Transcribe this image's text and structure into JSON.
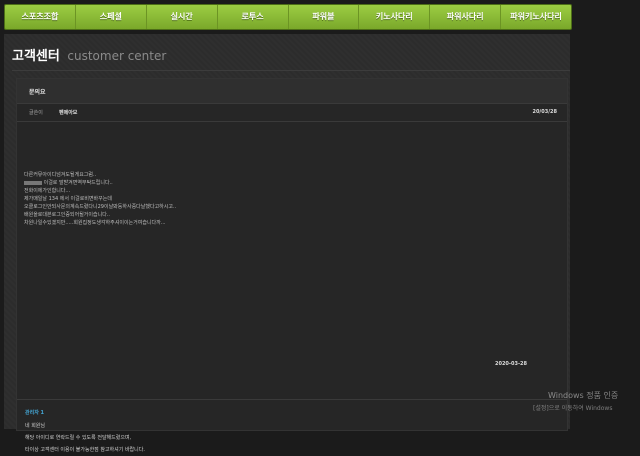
{
  "nav": {
    "items": [
      "스포츠조합",
      "스페셜",
      "실시간",
      "로투스",
      "파워볼",
      "키노사다리",
      "파워사다리",
      "파워키노사다리"
    ]
  },
  "page": {
    "title": "고객센터",
    "subtitle": "customer center"
  },
  "inquiry": {
    "header": "문의요",
    "author_label": "글쓴이",
    "author": "펜메아모",
    "date": "20/03/28",
    "lines": [
      "다른커뮤아이디넘겨도될게요그럼..",
      "이걸로 말받겨면역부탁드립니다..",
      "전화이에가인합니다...",
      "제가매일날 134 에서       이걸로비면바꾸는데",
      "오클로그인안되사문의계속드렸다니29이날봐둥하사중다날했다고하시고..",
      "배원을로대본로그인증되어될거이습니다..",
      "차원나일수있겠지만.....회원집정도생각하주셔이이는거여습니다까..."
    ]
  },
  "reply": {
    "author": "관리자 1",
    "lines": [
      "네 회원님",
      "해당 아이디로 연락드릴 수 있도록 전달해드렸으며,",
      "타이상 고객센터 이용이 불가능한점 참고하셔기 바랍니다."
    ],
    "date": "2020-03-28"
  },
  "watermark": {
    "line1": "Windows 정품 인증",
    "line2": "[설정]으로 이동하여 Windows"
  }
}
